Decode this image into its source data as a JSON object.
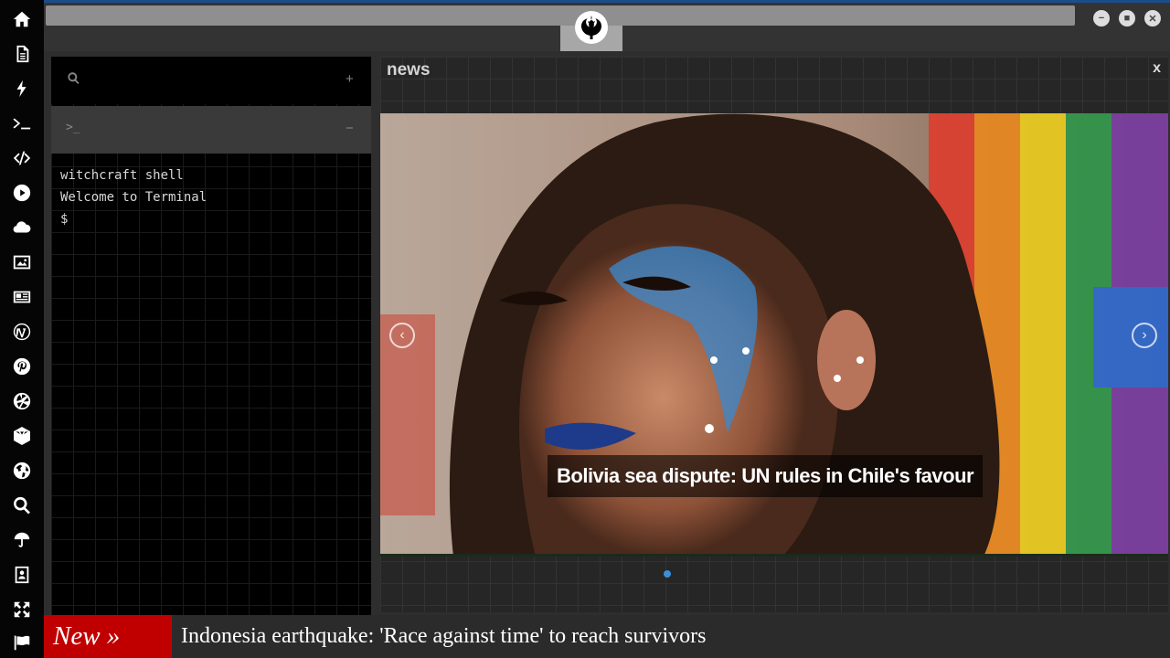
{
  "sidebar": {
    "icons": [
      "home-icon",
      "document-icon",
      "bolt-icon",
      "terminal-icon",
      "code-icon",
      "play-icon",
      "cloud-icon",
      "image-icon",
      "newspaper-icon",
      "wordpress-icon",
      "pinterest-icon",
      "aperture-icon",
      "polyhedron-icon",
      "globe-icon",
      "search-icon",
      "umbrella-icon",
      "contact-icon",
      "expand-icon",
      "flag-icon"
    ]
  },
  "topbar": {
    "url": "",
    "window_controls": [
      "minimize",
      "maximize",
      "close"
    ]
  },
  "terminal": {
    "search_icon": "search-icon",
    "add_label": "+",
    "prompt_symbol": ">_",
    "collapse_label": "−",
    "lines": [
      "witchcraft shell",
      "Welcome to Terminal",
      "$"
    ]
  },
  "news": {
    "title": "news",
    "close_label": "x",
    "caption": "Bolivia sea dispute: UN rules in Chile's favour",
    "prev_label": "‹",
    "next_label": "›",
    "active_slide": 1,
    "slide_count": 1
  },
  "ticker": {
    "label": "New »",
    "headline": "Indonesia earthquake: 'Race against time' to reach survivors"
  },
  "colors": {
    "ticker_red": "#c00000",
    "accent_blue": "#3a8fdc",
    "topbar_border": "#1a4e8a"
  }
}
